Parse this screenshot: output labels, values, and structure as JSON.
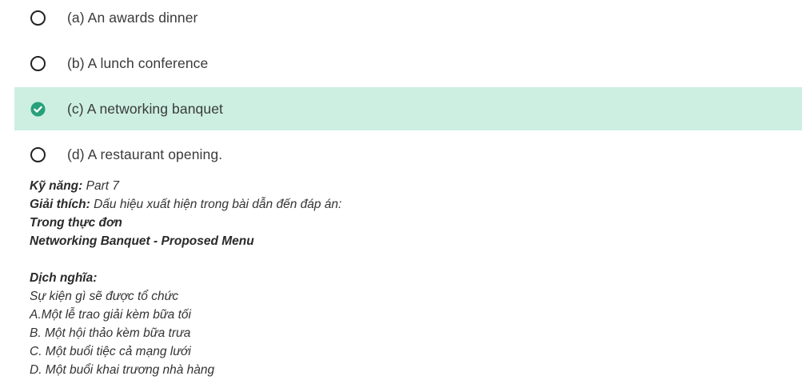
{
  "options": [
    {
      "label": "(a) An awards dinner",
      "selected": false
    },
    {
      "label": "(b) A lunch conference",
      "selected": false
    },
    {
      "label": "(c) A networking banquet",
      "selected": true
    },
    {
      "label": "(d) A restaurant opening.",
      "selected": false
    }
  ],
  "icons": {
    "unselected": "radio-empty-icon",
    "correct": "check-circle-icon"
  },
  "colors": {
    "correct_background": "#ccefe2",
    "check_green": "#26a17b"
  },
  "explanation": {
    "skill_label": "Kỹ năng:",
    "skill_value": " Part 7",
    "explain_label": "Giải thích:",
    "explain_value": " Dấu hiệu xuất hiện trong bài dẫn đến đáp án:",
    "evidence_line1": "Trong thực đơn",
    "evidence_line2": "Networking Banquet - Proposed Menu",
    "translation_label": "Dịch nghĩa:",
    "translation_lines": [
      "Sự kiện gì sẽ được tổ chức",
      "A.Một lễ trao giải kèm bữa tối",
      "B. Một hội thảo kèm bữa trưa",
      "C. Một buổi tiệc cả mạng lưới",
      "D. Một buổi khai trương nhà hàng"
    ]
  }
}
